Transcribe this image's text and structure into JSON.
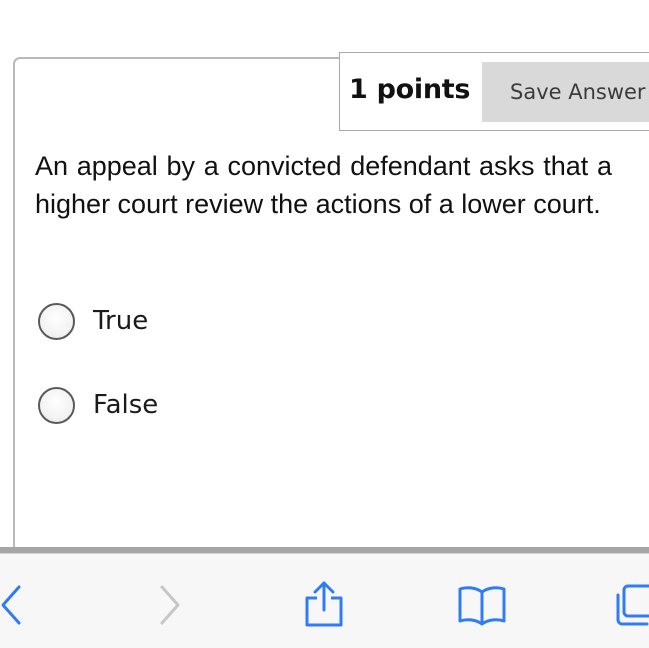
{
  "question": {
    "points_label": "1 points",
    "save_button_label": "Save Answer",
    "text": "An appeal by a convicted defendant asks that a higher court review the actions of a lower court.",
    "options": [
      {
        "label": "True",
        "selected": false
      },
      {
        "label": "False",
        "selected": false
      }
    ]
  },
  "browser_toolbar": {
    "icons": [
      "back-icon",
      "forward-icon",
      "share-icon",
      "bookmarks-icon",
      "tabs-icon"
    ],
    "accent_color": "#2f7cf6",
    "disabled_color": "#c6c6c6"
  }
}
